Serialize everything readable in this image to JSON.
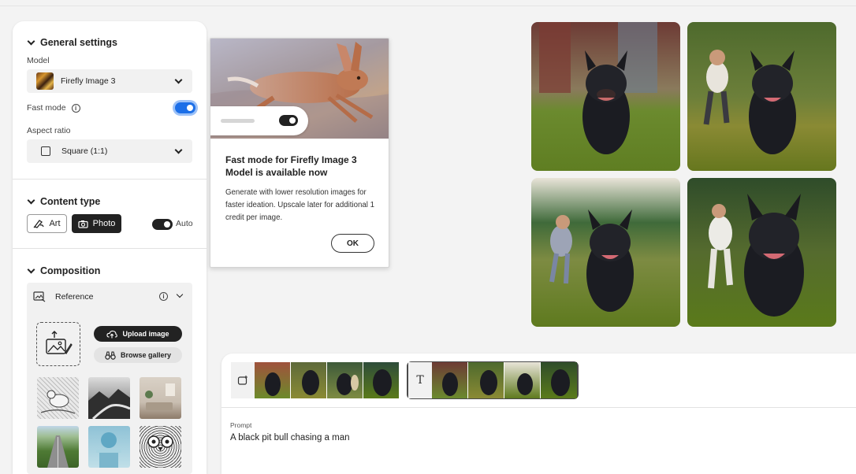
{
  "sidebar": {
    "general": {
      "title": "General settings",
      "model_label": "Model",
      "model_value": "Firefly Image 3",
      "fast_mode_label": "Fast mode",
      "fast_mode_on": true,
      "aspect_label": "Aspect ratio",
      "aspect_value": "Square (1:1)"
    },
    "content_type": {
      "title": "Content type",
      "art_label": "Art",
      "photo_label": "Photo",
      "auto_label": "Auto",
      "auto_on": true,
      "selected": "Photo"
    },
    "composition": {
      "title": "Composition",
      "reference_label": "Reference",
      "upload_label": "Upload image",
      "browse_label": "Browse gallery",
      "gallery": [
        "sketch-bird",
        "mountain-landscape",
        "living-room",
        "road-field",
        "blue-sphere",
        "owl-sketch"
      ]
    }
  },
  "popup": {
    "title": "Fast mode for Firefly Image 3 Model is available now",
    "body": "Generate with lower resolution images for faster ideation. Upscale later for additional 1 credit per image.",
    "ok_label": "OK"
  },
  "results": {
    "images": [
      "pit-bull-running-1",
      "pit-bull-running-2",
      "pit-bull-running-3",
      "pit-bull-running-4"
    ]
  },
  "history": {
    "groups": [
      {
        "icon": "image-edit-icon",
        "selected": false,
        "count": 4
      },
      {
        "icon": "text-icon",
        "icon_text": "T",
        "selected": true,
        "count": 4
      }
    ]
  },
  "prompt": {
    "label": "Prompt",
    "text": "A black pit bull chasing a man"
  },
  "colors": {
    "accent_blue": "#1c6fe8",
    "dark": "#222222",
    "panel_bg": "#ffffff",
    "page_bg": "#f3f3f3"
  }
}
